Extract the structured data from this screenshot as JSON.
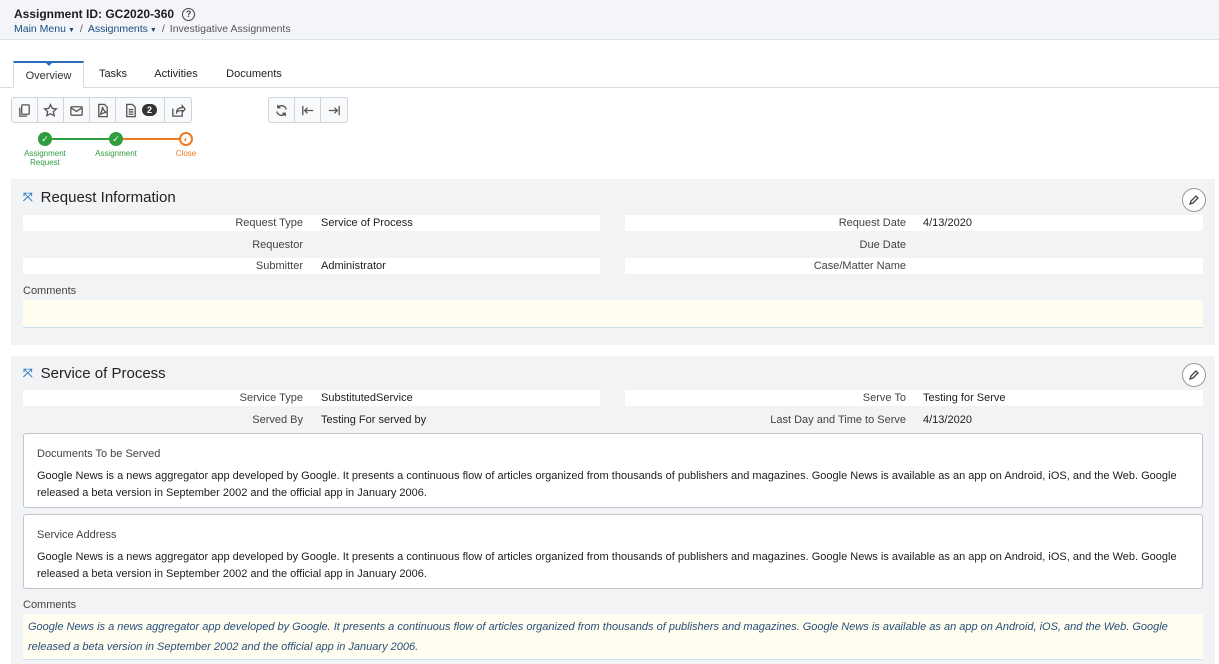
{
  "header": {
    "title": "Assignment ID: GC2020-360",
    "breadcrumb": {
      "main_menu": "Main Menu",
      "assignments": "Assignments",
      "separator": "/",
      "current": "Investigative Assignments"
    }
  },
  "tabs": [
    {
      "label": "Overview",
      "active": true
    },
    {
      "label": "Tasks",
      "active": false
    },
    {
      "label": "Activities",
      "active": false
    },
    {
      "label": "Documents",
      "active": false
    }
  ],
  "toolbar": {
    "buttons": [
      "copy-icon",
      "star-icon",
      "email-icon",
      "pdf-icon",
      "document-icon",
      "share-icon",
      "refresh-icon",
      "first-icon",
      "last-icon"
    ],
    "document_count": "2"
  },
  "progress": {
    "steps": [
      {
        "label": "Assignment Request",
        "state": "done",
        "color": "#2e9e3f"
      },
      {
        "label": "Assignment",
        "state": "done",
        "color": "#2e9e3f"
      },
      {
        "label": "Close",
        "state": "current",
        "color": "#ee7b22"
      }
    ]
  },
  "request_info": {
    "heading": "Request Information",
    "fields": {
      "request_type": {
        "label": "Request Type",
        "value": "Service of Process"
      },
      "request_date": {
        "label": "Request Date",
        "value": "4/13/2020"
      },
      "requestor": {
        "label": "Requestor",
        "value": ""
      },
      "due_date": {
        "label": "Due Date",
        "value": ""
      },
      "submitter": {
        "label": "Submitter",
        "value": "Administrator"
      },
      "case_matter": {
        "label": "Case/Matter Name",
        "value": ""
      }
    },
    "comments_label": "Comments",
    "comments": ""
  },
  "service": {
    "heading": "Service of Process",
    "fields": {
      "service_type": {
        "label": "Service Type",
        "value": "SubstitutedService"
      },
      "serve_to": {
        "label": "Serve To",
        "value": "Testing for Serve"
      },
      "served_by": {
        "label": "Served By",
        "value": "Testing For served by"
      },
      "last_day": {
        "label": "Last Day and Time to Serve",
        "value": "4/13/2020"
      }
    },
    "documents": {
      "title": "Documents To be Served",
      "body": "Google News is a news aggregator app developed by Google. It presents a continuous flow of articles organized from thousands of publishers and magazines. Google News is available as an app on Android, iOS, and the Web. Google released a beta version in September 2002 and the official app in January 2006."
    },
    "address": {
      "title": "Service Address",
      "body": "Google News is a news aggregator app developed by Google. It presents a continuous flow of articles organized from thousands of publishers and magazines. Google News is available as an app on Android, iOS, and the Web. Google released a beta version in September 2002 and the official app in January 2006."
    },
    "comments_label": "Comments",
    "comments": "Google News is a news aggregator app developed by Google. It presents a continuous flow of articles organized from thousands of publishers and magazines. Google News is available as an app on Android, iOS, and the Web. Google released a beta version in September 2002 and the official app in January 2006."
  }
}
